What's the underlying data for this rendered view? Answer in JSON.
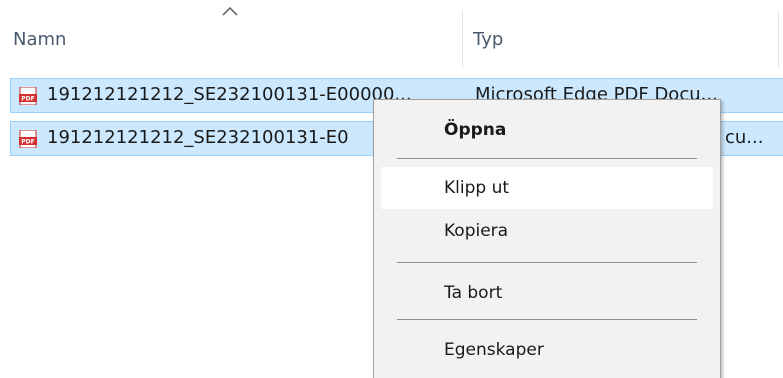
{
  "header": {
    "name_label": "Namn",
    "type_label": "Typ",
    "sort_icon": "chevron-up-icon"
  },
  "files": [
    {
      "name": "191212121212_SE232100131-E00000...",
      "type": "Microsoft Edge PDF Docu...",
      "icon": "pdf-icon",
      "selected": true
    },
    {
      "name": "191212121212_SE232100131-E0",
      "type": "cu...",
      "icon": "pdf-icon",
      "selected": true
    }
  ],
  "context_menu": {
    "items": [
      {
        "label": "Öppna",
        "default": true
      },
      {
        "label": "Klipp ut",
        "highlighted": true
      },
      {
        "label": "Kopiera"
      },
      {
        "label": "Ta bort"
      },
      {
        "label": "Egenskaper"
      }
    ]
  },
  "colors": {
    "selection_fill": "#cce8ff",
    "selection_border": "#99d1ff",
    "menu_background": "#f2f2f2",
    "menu_hover": "#ffffff",
    "pdf_icon_red": "#d32f2f"
  }
}
